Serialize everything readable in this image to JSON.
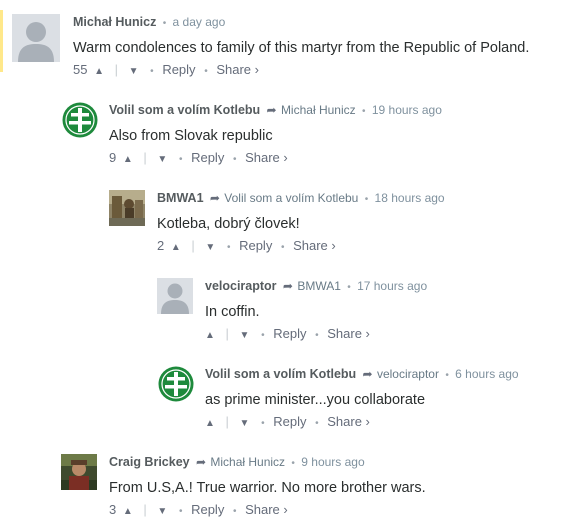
{
  "comments": [
    {
      "author": "Michał Hunicz",
      "parent": "",
      "time": "a day ago",
      "text": "Warm condolences to family of this martyr from the Republic of Poland.",
      "votes": "55",
      "reply": "Reply",
      "share": "Share ›"
    },
    {
      "author": "Volil som a volím Kotlebu",
      "parent": "Michał Hunicz",
      "time": "19 hours ago",
      "text": "Also from Slovak republic",
      "votes": "9",
      "reply": "Reply",
      "share": "Share ›"
    },
    {
      "author": "BMWA1",
      "parent": "Volil som a volím Kotlebu",
      "time": "18 hours ago",
      "text": "Kotleba, dobrý človek!",
      "votes": "2",
      "reply": "Reply",
      "share": "Share ›"
    },
    {
      "author": "velociraptor",
      "parent": "BMWA1",
      "time": "17 hours ago",
      "text": "In coffin.",
      "votes": "",
      "reply": "Reply",
      "share": "Share ›"
    },
    {
      "author": "Volil som a volím Kotlebu",
      "parent": "velociraptor",
      "time": "6 hours ago",
      "text": "as prime minister...you collaborate",
      "votes": "",
      "reply": "Reply",
      "share": "Share ›"
    },
    {
      "author": "Craig Brickey",
      "parent": "Michał Hunicz",
      "time": "9 hours ago",
      "text": "From U.S,A.! True warrior. No more brother wars.",
      "votes": "3",
      "reply": "Reply",
      "share": "Share ›"
    }
  ],
  "icons": {
    "upvote": "chevron-up-icon",
    "downvote": "chevron-down-icon",
    "reply_arrow": "reply-arrow-icon"
  },
  "colors": {
    "highlight": "#ffe88a",
    "emblem_green": "#1e8a3c"
  }
}
